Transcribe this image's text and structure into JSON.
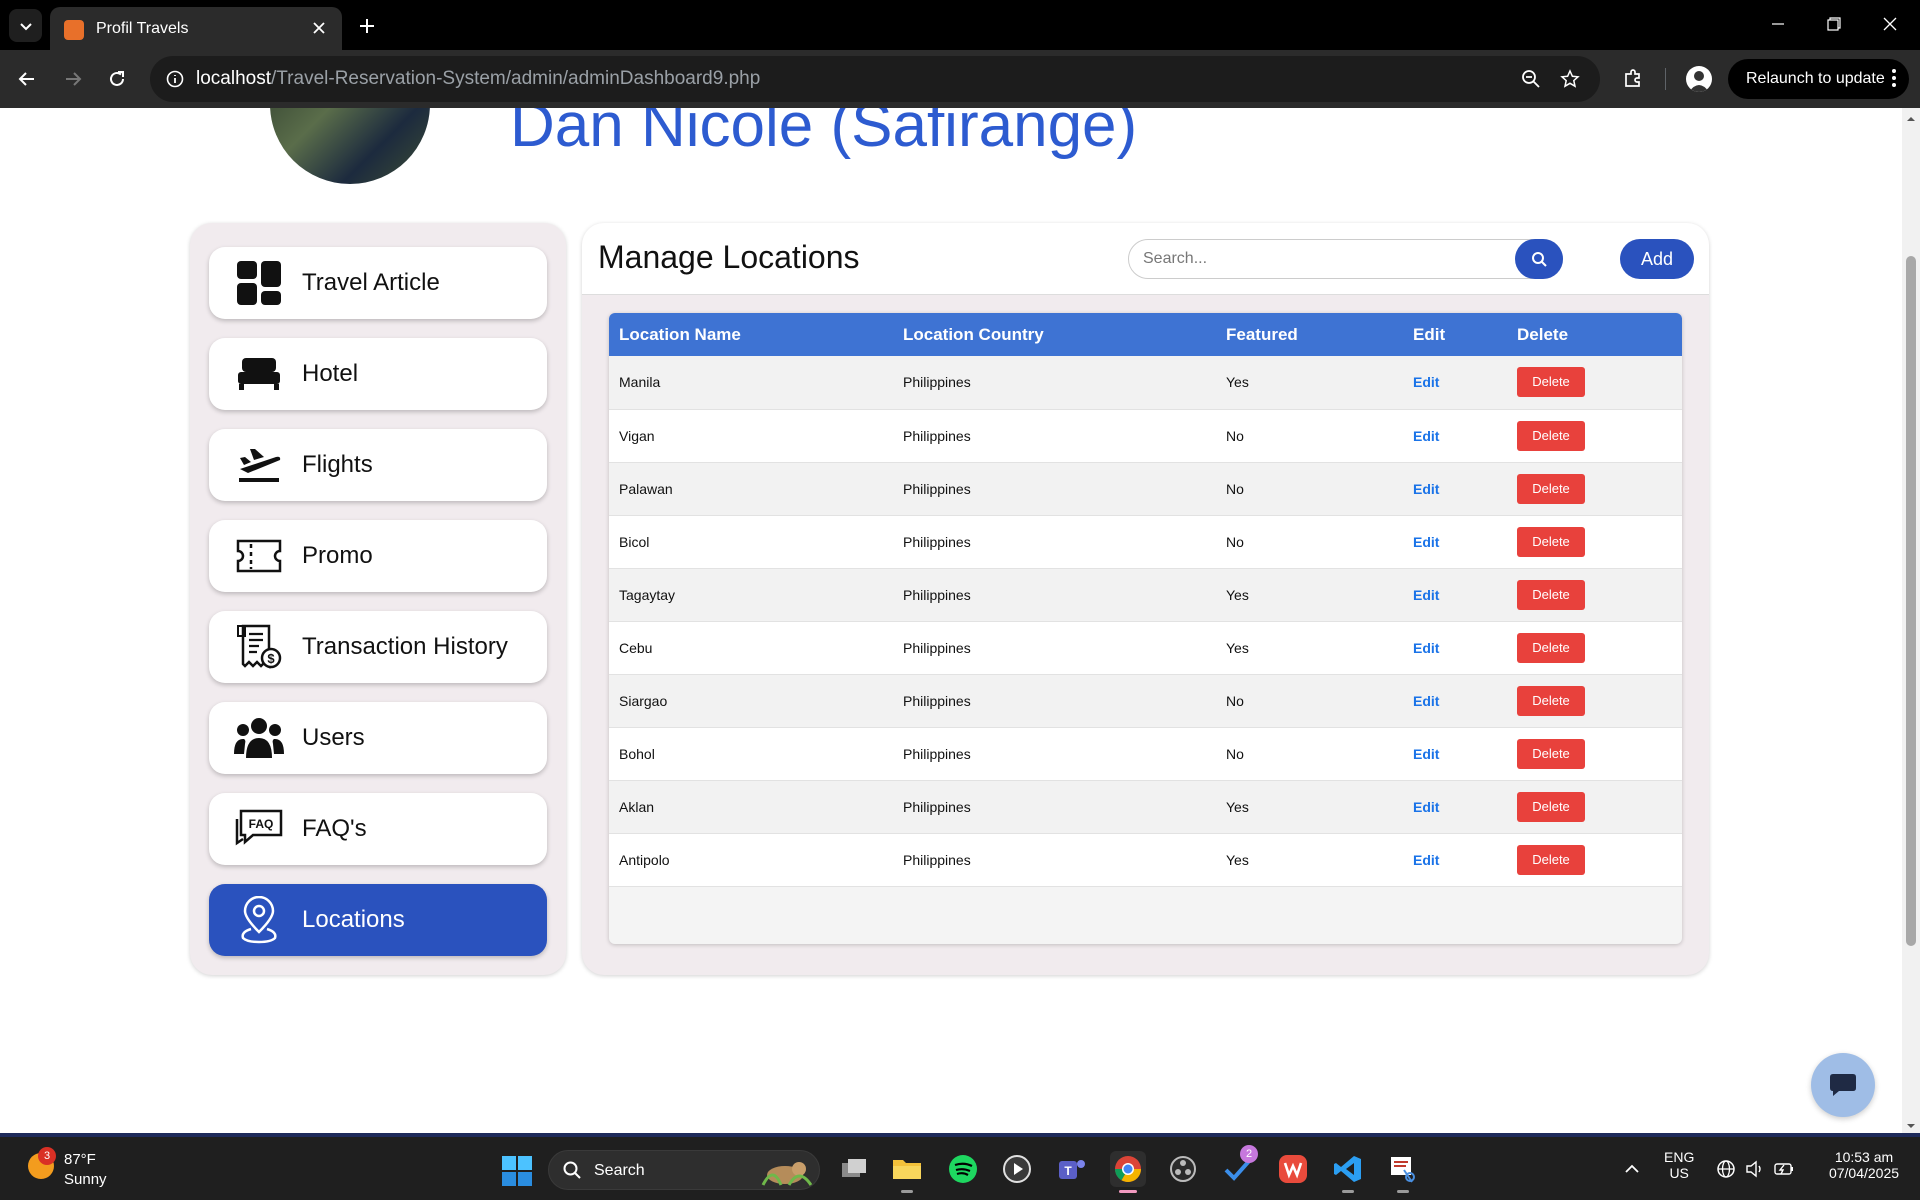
{
  "browser": {
    "tab_title": "Profil Travels",
    "url_host": "localhost",
    "url_path": "/Travel-Reservation-System/admin/adminDashboard9.php",
    "relaunch_label": "Relaunch to update"
  },
  "profile": {
    "name": "Dan Nicole (Safirange)"
  },
  "sidebar": {
    "items": [
      {
        "label": "Travel Article",
        "icon": "dashboard-icon"
      },
      {
        "label": "Hotel",
        "icon": "bed-icon"
      },
      {
        "label": "Flights",
        "icon": "plane-departure-icon"
      },
      {
        "label": "Promo",
        "icon": "ticket-icon"
      },
      {
        "label": "Transaction History",
        "icon": "receipt-icon"
      },
      {
        "label": "Users",
        "icon": "users-icon"
      },
      {
        "label": "FAQ's",
        "icon": "faq-icon"
      },
      {
        "label": "Locations",
        "icon": "location-pin-icon",
        "active": true
      }
    ]
  },
  "main": {
    "title": "Manage Locations",
    "search_placeholder": "Search...",
    "add_label": "Add",
    "table": {
      "columns": [
        "Location Name",
        "Location Country",
        "Featured",
        "Edit",
        "Delete"
      ],
      "rows": [
        {
          "name": "Manila",
          "country": "Philippines",
          "featured": "Yes",
          "edit": "Edit",
          "delete": "Delete"
        },
        {
          "name": "Vigan",
          "country": "Philippines",
          "featured": "No",
          "edit": "Edit",
          "delete": "Delete"
        },
        {
          "name": "Palawan",
          "country": "Philippines",
          "featured": "No",
          "edit": "Edit",
          "delete": "Delete"
        },
        {
          "name": "Bicol",
          "country": "Philippines",
          "featured": "No",
          "edit": "Edit",
          "delete": "Delete"
        },
        {
          "name": "Tagaytay",
          "country": "Philippines",
          "featured": "Yes",
          "edit": "Edit",
          "delete": "Delete"
        },
        {
          "name": "Cebu",
          "country": "Philippines",
          "featured": "Yes",
          "edit": "Edit",
          "delete": "Delete"
        },
        {
          "name": "Siargao",
          "country": "Philippines",
          "featured": "No",
          "edit": "Edit",
          "delete": "Delete"
        },
        {
          "name": "Bohol",
          "country": "Philippines",
          "featured": "No",
          "edit": "Edit",
          "delete": "Delete"
        },
        {
          "name": "Aklan",
          "country": "Philippines",
          "featured": "Yes",
          "edit": "Edit",
          "delete": "Delete"
        },
        {
          "name": "Antipolo",
          "country": "Philippines",
          "featured": "Yes",
          "edit": "Edit",
          "delete": "Delete"
        }
      ]
    }
  },
  "taskbar": {
    "weather_temp": "87°F",
    "weather_desc": "Sunny",
    "weather_badge": "3",
    "search_label": "Search",
    "todo_badge": "2",
    "lang_line1": "ENG",
    "lang_line2": "US",
    "time": "10:53 am",
    "date": "07/04/2025"
  },
  "colors": {
    "primary": "#2a52be",
    "table_header": "#3e73d3",
    "delete": "#e8413c",
    "edit_link": "#1a73e8",
    "profile_name": "#2d5bd0",
    "panel_bg": "#f1ebee"
  }
}
